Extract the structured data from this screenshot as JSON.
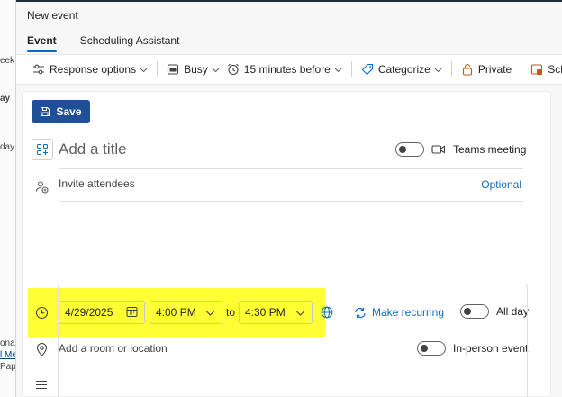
{
  "window": {
    "title": "New event"
  },
  "tabs": [
    {
      "label": "Event",
      "active": true
    },
    {
      "label": "Scheduling Assistant",
      "active": false
    }
  ],
  "toolbar": {
    "response_options": "Response options",
    "busy": "Busy",
    "reminder": "15 minutes before",
    "categorize": "Categorize",
    "private": "Private",
    "scheduling": "Scheduli"
  },
  "form": {
    "save_label": "Save",
    "title_placeholder": "Add a title",
    "teams_meeting_label": "Teams meeting",
    "attendees_placeholder": "Invite attendees",
    "optional_label": "Optional",
    "start_date": "4/29/2025",
    "start_time": "4:00 PM",
    "to_label": "to",
    "end_time": "4:30 PM",
    "make_recurring": "Make recurring",
    "all_day_label": "All day",
    "location_placeholder": "Add a room or location",
    "in_person_label": "In-person event"
  },
  "background": {
    "fragments": [
      "eek",
      "ay",
      "day",
      "onal",
      "l Me",
      "Pap"
    ]
  },
  "colors": {
    "accent": "#0f6cbd",
    "save_bg": "#1f4f96",
    "highlight": "#ffff33",
    "text": "#242424"
  }
}
